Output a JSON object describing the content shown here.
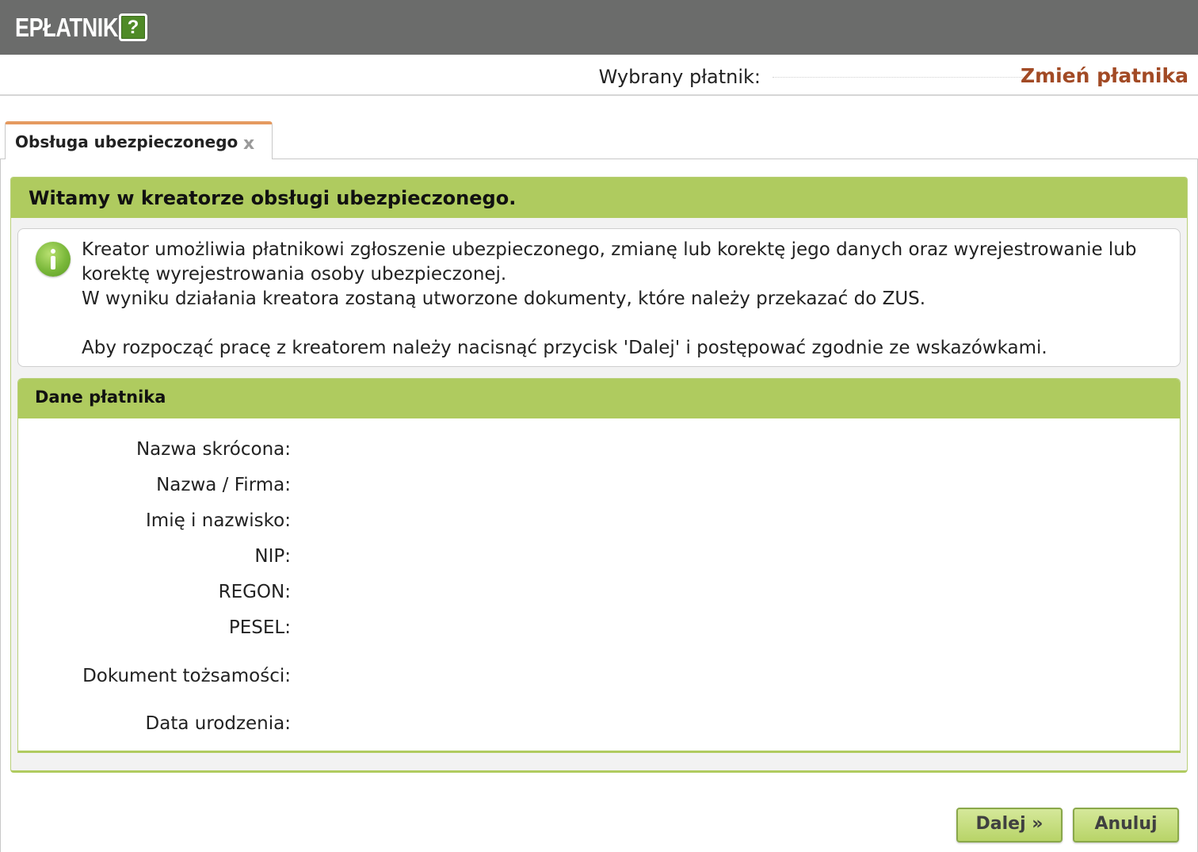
{
  "app": {
    "brand": "EPŁATNIK",
    "help_label": "?"
  },
  "payer_bar": {
    "label": "Wybrany płatnik:",
    "value": "",
    "change_link": "Zmień płatnika"
  },
  "tabs": [
    {
      "label": "Obsługa ubezpieczonego",
      "close": "x"
    }
  ],
  "wizard": {
    "title": "Witamy w kreatorze obsługi ubezpieczonego.",
    "info_lines": [
      "Kreator umożliwia płatnikowi zgłoszenie ubezpieczonego, zmianę lub korektę jego danych oraz wyrejestrowanie lub korektę wyrejestrowania osoby ubezpieczonej.",
      "W wyniku działania kreatora zostaną utworzone dokumenty, które należy przekazać do ZUS.",
      "Aby rozpocząć pracę z kreatorem należy nacisnąć przycisk 'Dalej' i postępować zgodnie ze wskazówkami."
    ],
    "payer_data": {
      "title": "Dane płatnika",
      "fields": [
        {
          "label": "Nazwa skrócona:",
          "value": ""
        },
        {
          "label": "Nazwa / Firma:",
          "value": ""
        },
        {
          "label": "Imię i nazwisko:",
          "value": ""
        },
        {
          "label": "NIP:",
          "value": ""
        },
        {
          "label": "REGON:",
          "value": ""
        },
        {
          "label": "PESEL:",
          "value": ""
        },
        {
          "label": "Dokument tożsamości:",
          "value": ""
        },
        {
          "label": "Data urodzenia:",
          "value": ""
        }
      ]
    }
  },
  "buttons": {
    "next": "Dalej »",
    "cancel": "Anuluj"
  },
  "colors": {
    "topbar": "#6b6c6b",
    "accent_green": "#afcb5f",
    "link_brown": "#a24a25",
    "tab_accent": "#e59a60"
  }
}
